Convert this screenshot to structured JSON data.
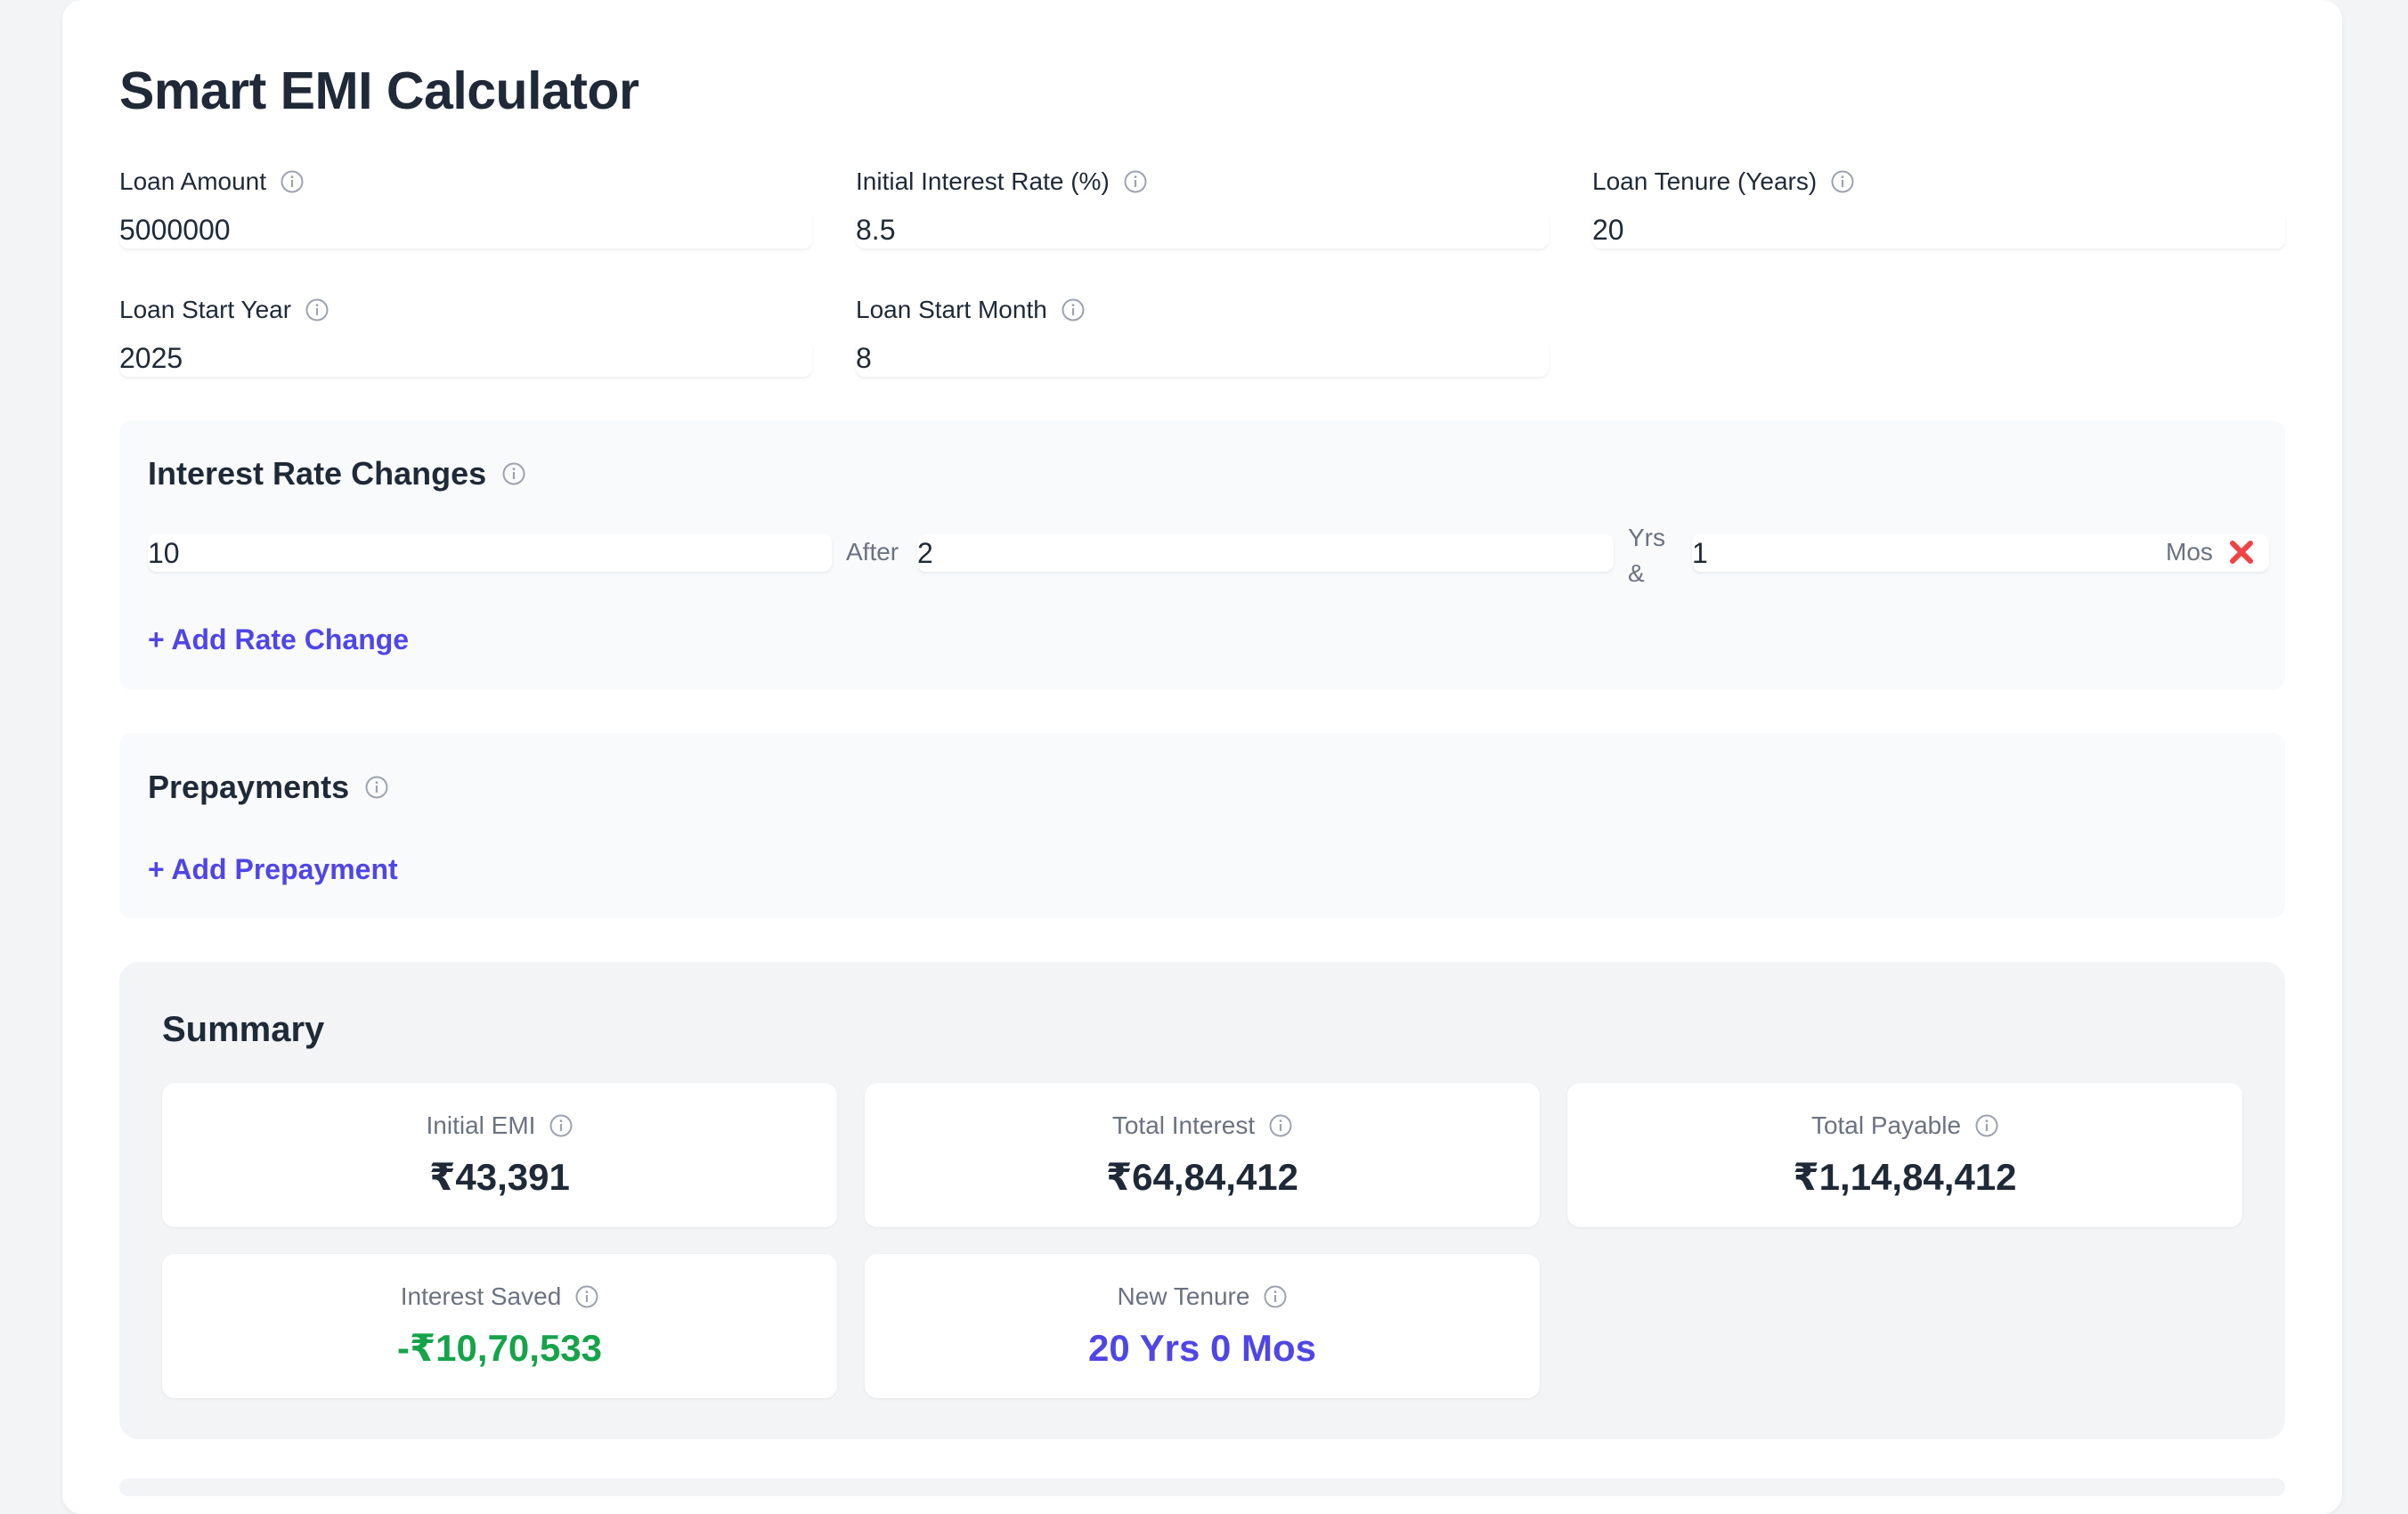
{
  "title": "Smart EMI Calculator",
  "fields": {
    "loan_amount": {
      "label": "Loan Amount",
      "value": "5000000"
    },
    "initial_rate": {
      "label": "Initial Interest Rate (%)",
      "value": "8.5"
    },
    "tenure": {
      "label": "Loan Tenure (Years)",
      "value": "20"
    },
    "start_year": {
      "label": "Loan Start Year",
      "value": "2025"
    },
    "start_month": {
      "label": "Loan Start Month",
      "value": "8"
    }
  },
  "rate_changes": {
    "title": "Interest Rate Changes",
    "rows": [
      {
        "rate": "10",
        "after_label": "After",
        "years": "2",
        "yrs_label": "Yrs &",
        "months": "1",
        "mos_label": "Mos"
      }
    ],
    "add_label": "+ Add Rate Change"
  },
  "prepayments": {
    "title": "Prepayments",
    "add_label": "+ Add Prepayment"
  },
  "summary": {
    "title": "Summary",
    "initial_emi": {
      "label": "Initial EMI",
      "value": "₹43,391"
    },
    "total_interest": {
      "label": "Total Interest",
      "value": "₹64,84,412"
    },
    "total_payable": {
      "label": "Total Payable",
      "value": "₹1,14,84,412"
    },
    "interest_saved": {
      "label": "Interest Saved",
      "value": "-₹10,70,533"
    },
    "new_tenure": {
      "label": "New Tenure",
      "value": "20 Yrs 0 Mos"
    }
  },
  "icons": {
    "info": "info-circle-icon",
    "remove": "close-x-icon"
  },
  "colors": {
    "accent": "#4f46e5",
    "positive": "#16a34a",
    "danger": "#ef4444",
    "muted": "#6b7280",
    "text": "#1f2937"
  }
}
